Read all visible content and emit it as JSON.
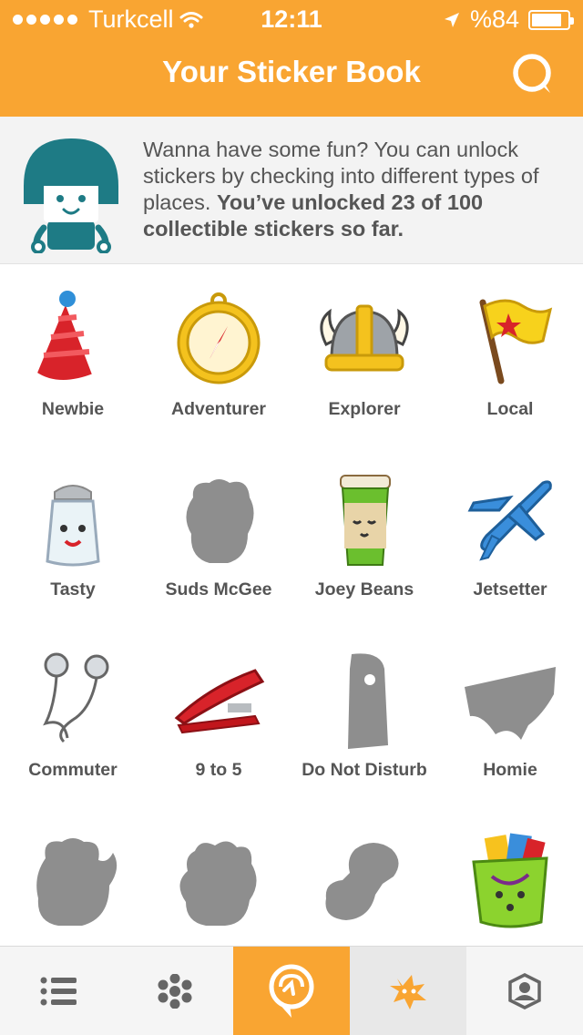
{
  "status_bar": {
    "carrier": "Turkcell",
    "time": "12:11",
    "battery": "%84",
    "battery_level": 0.84
  },
  "header": {
    "title": "Your Sticker Book",
    "search_icon": "search-bubble-icon"
  },
  "intro": {
    "text": "Wanna have some fun? You can unlock stickers by checking into different types of places.",
    "bold_text": "You’ve unlocked 23 of 100 collectible stickers so far."
  },
  "stickers": [
    {
      "label": "Newbie",
      "icon": "party-hat-icon",
      "unlocked": true
    },
    {
      "label": "Adventurer",
      "icon": "compass-icon",
      "unlocked": true
    },
    {
      "label": "Explorer",
      "icon": "viking-helmet-icon",
      "unlocked": true
    },
    {
      "label": "Local",
      "icon": "flag-icon",
      "unlocked": true
    },
    {
      "label": "Tasty",
      "icon": "salt-shaker-icon",
      "unlocked": true
    },
    {
      "label": "Suds McGee",
      "icon": "locked-sticker-icon",
      "unlocked": false
    },
    {
      "label": "Joey Beans",
      "icon": "coffee-cup-icon",
      "unlocked": true
    },
    {
      "label": "Jetsetter",
      "icon": "airplane-icon",
      "unlocked": true
    },
    {
      "label": "Commuter",
      "icon": "earbuds-icon",
      "unlocked": true
    },
    {
      "label": "9 to 5",
      "icon": "stapler-icon",
      "unlocked": true
    },
    {
      "label": "Do Not Disturb",
      "icon": "door-hanger-icon",
      "unlocked": false
    },
    {
      "label": "Homie",
      "icon": "underwear-icon",
      "unlocked": false
    },
    {
      "label": "",
      "icon": "locked-sticker-icon",
      "unlocked": false
    },
    {
      "label": "",
      "icon": "locked-sticker-icon",
      "unlocked": false
    },
    {
      "label": "",
      "icon": "locked-sticker-icon",
      "unlocked": false
    },
    {
      "label": "",
      "icon": "shopping-bag-icon",
      "unlocked": true
    }
  ],
  "tabs": [
    {
      "icon": "list-icon"
    },
    {
      "icon": "honeycomb-icon"
    },
    {
      "icon": "check-in-pin-icon"
    },
    {
      "icon": "sticker-burst-icon",
      "active": true
    },
    {
      "icon": "profile-icon"
    }
  ],
  "colors": {
    "brand_orange": "#F9A532",
    "mascot_teal": "#1E7B85",
    "locked_gray": "#8E8E8E",
    "text_gray": "#555555"
  }
}
